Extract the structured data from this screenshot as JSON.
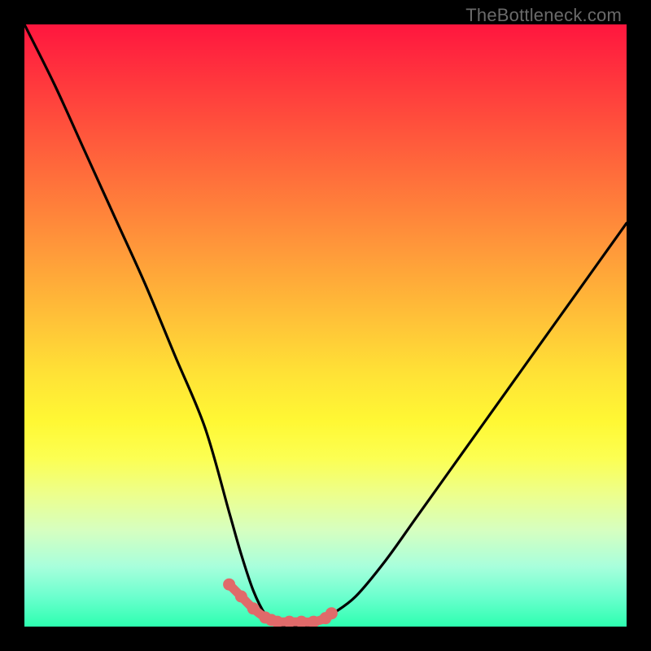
{
  "watermark": "TheBottleneck.com",
  "chart_data": {
    "type": "line",
    "title": "",
    "xlabel": "",
    "ylabel": "",
    "xlim": [
      0,
      100
    ],
    "ylim": [
      0,
      100
    ],
    "x": [
      0,
      5,
      10,
      15,
      20,
      25,
      30,
      34,
      36,
      38,
      40,
      42,
      44,
      46,
      48,
      51,
      55,
      60,
      65,
      70,
      75,
      80,
      85,
      90,
      95,
      100
    ],
    "values": [
      100,
      90,
      79,
      68,
      57,
      45,
      33,
      19,
      12,
      6,
      2,
      0,
      0,
      0,
      0,
      2,
      5,
      11,
      18,
      25,
      32,
      39,
      46,
      53,
      60,
      67
    ],
    "marker_points": {
      "x": [
        34,
        36,
        38,
        40,
        41,
        42,
        44,
        46,
        48,
        50,
        51
      ],
      "y": [
        7,
        5,
        3,
        1.5,
        1.1,
        0.8,
        0.8,
        0.8,
        0.8,
        1.4,
        2.2
      ]
    },
    "gradient_colormap": "red-yellow-green vertical"
  }
}
